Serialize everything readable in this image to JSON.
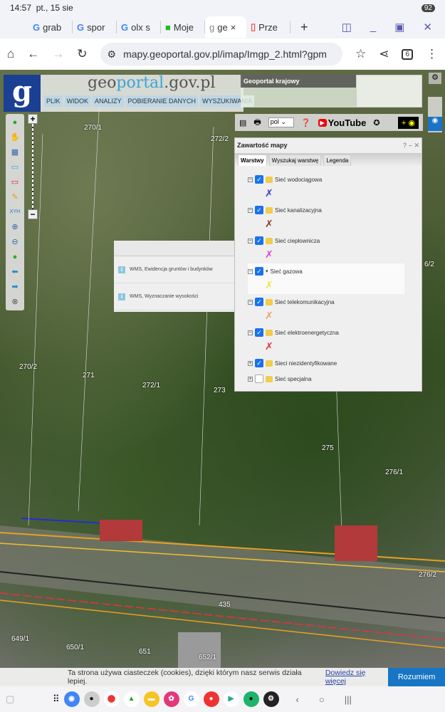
{
  "status": {
    "time": "14:57",
    "date": "pt., 15 sie",
    "battery": "92"
  },
  "tabs": [
    {
      "icon": "G",
      "label": "grab"
    },
    {
      "icon": "G",
      "label": "spor"
    },
    {
      "icon": "G",
      "label": "olx s"
    },
    {
      "icon": "■",
      "label": "Moje"
    },
    {
      "icon": "g",
      "label": "ge",
      "close": "×"
    },
    {
      "icon": "▯",
      "label": "Prze"
    }
  ],
  "browser": {
    "url": "mapy.geoportal.gov.pl/imap/Imgp_2.html?gpm",
    "tab_count": "6"
  },
  "geoportal": {
    "logo": "g",
    "brand_a": "geo",
    "brand_b": "portal",
    ".gov": "",
    "brand_c": ".gov.pl",
    "menu": [
      "PLIK",
      "WIDOK",
      "ANALIZY",
      "POBIERANIE DANYCH",
      "WYSZUKIWANIA"
    ],
    "krajowy": "Geoportal krajowy",
    "lang": "pol",
    "youtube": "YouTube"
  },
  "info_popup": {
    "rows": [
      "WMS, Ewidencja gruntów i budynków",
      "WMS, Wyznaczanie wysokości"
    ]
  },
  "panel": {
    "title": "Zawartość mapy",
    "help": "?",
    "tabs": [
      "Warstwy",
      "Wyszukaj warstwę",
      "Legenda"
    ],
    "layers": [
      {
        "name": "Sieć wodociągowa",
        "checked": true,
        "color": "#3b3bd0"
      },
      {
        "name": "Sieć kanalizacyjna",
        "checked": true,
        "color": "#8a3a2a"
      },
      {
        "name": "Sieć ciepłownicza",
        "checked": true,
        "color": "#e040d0"
      },
      {
        "name": "Sieć gazowa",
        "checked": true,
        "color": "#e8e840"
      },
      {
        "name": "Sieć telekomunikacyjna",
        "checked": true,
        "color": "#f0a070"
      },
      {
        "name": "Sieć elektroenergetyczna",
        "checked": true,
        "color": "#e83040"
      },
      {
        "name": "Sieci niezidentyfikowane",
        "checked": true
      },
      {
        "name": "Sieć specjalna",
        "checked": false
      }
    ]
  },
  "map_labels": [
    "270/1",
    "272/2",
    "270/2",
    "271",
    "272/1",
    "273",
    "275",
    "276/1",
    "435",
    "649/1",
    "650/1",
    "651",
    "652/1",
    "276/2",
    "6/2"
  ],
  "cookie": {
    "text": "Ta strona używa ciasteczek (cookies), dzięki którym nasz serwis działa lepiej.",
    "link": "Dowiedz się więcej",
    "button": "Rozumiem"
  }
}
